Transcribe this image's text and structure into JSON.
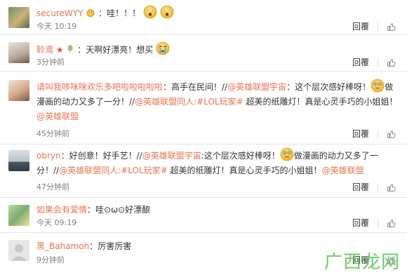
{
  "comments": [
    {
      "name": "secureWYY",
      "text": "：哇！！！",
      "time": "今天 10:19",
      "reply": "回覆",
      "like_count": ""
    },
    {
      "name": "聆鸢",
      "text": "：天啊好漂亮！想买",
      "time": "3分钟前",
      "reply": "回覆",
      "like_count": ""
    },
    {
      "name": "请叫我哆咪咪欢乐多吧啦啦啦啦啦",
      "text_a": "：高手在民间！//",
      "mention_a": "@英雄联盟宇宙",
      "text_b": "：这个层次感好棒呀！",
      "text_c": "做漫画的动力又多了一分！//",
      "mention_b": "@英雄联盟同人:#LOL玩家#",
      "text_d": " 超美的纸雕灯！真是心灵手巧的小姐姐！",
      "mention_c": "@英雄联盟",
      "time": "45分钟前",
      "reply": "回覆",
      "like_count": ""
    },
    {
      "name": "obryn",
      "text_a": "：好创意！好手艺！//",
      "mention_a": "@英雄联盟宇宙",
      "text_b": ":这个层次感好棒呀！",
      "text_c": "做漫画的动力又多了一分！//",
      "mention_b": "@英雄联盟同人:#LOL玩家#",
      "text_d": " 超美的纸雕灯！真是心灵手巧的小姐姐！",
      "mention_c": "@英雄联盟",
      "time": "47分钟前",
      "reply": "回覆",
      "like_count": ""
    },
    {
      "name": "如果会有爱情",
      "text": "：哇⊙ω⊙好漂酿",
      "time": "今天 09:19",
      "reply": "回覆",
      "like_count": ""
    },
    {
      "name": "黑_Bahamoh",
      "text": "：厉害厉害",
      "time": "9分钟前",
      "reply": "回覆",
      "like_count": ""
    }
  ],
  "watermark": "广西龙网",
  "icons": {
    "like": "thumbs-up-icon",
    "emoji_face": "smiley-face-icon"
  },
  "colors": {
    "name": "#eb7350",
    "text": "#333333",
    "meta": "#808080"
  }
}
